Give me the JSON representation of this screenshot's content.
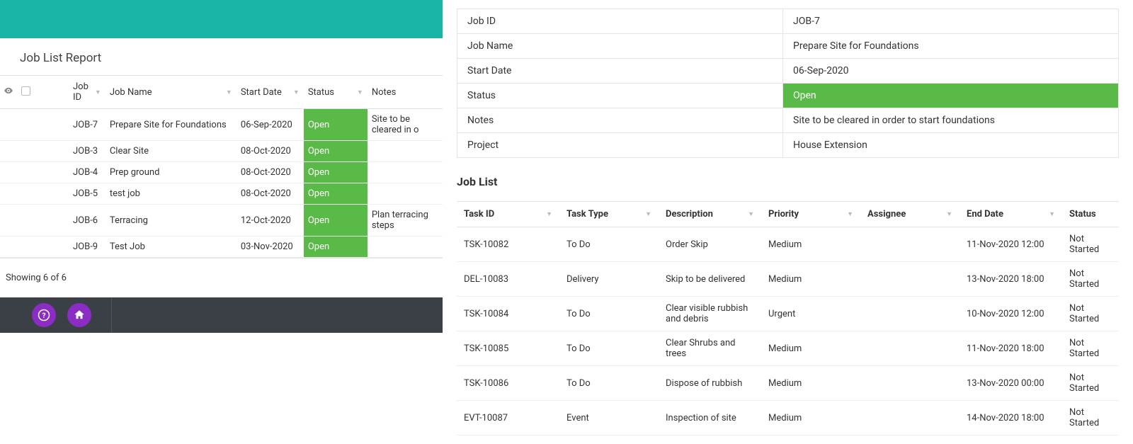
{
  "colors": {
    "teal": "#1bb5a7",
    "green": "#5aba47",
    "purple": "#8b2cc4",
    "darkFooter": "#3b3f46"
  },
  "left": {
    "reportTitle": "Job List Report",
    "headers": {
      "jobId": "Job ID",
      "jobName": "Job Name",
      "startDate": "Start Date",
      "status": "Status",
      "notes": "Notes"
    },
    "rows": [
      {
        "jobId": "JOB-7",
        "jobName": "Prepare Site for Foundations",
        "startDate": "06-Sep-2020",
        "status": "Open",
        "notes": "Site to be cleared in o"
      },
      {
        "jobId": "JOB-3",
        "jobName": "Clear Site",
        "startDate": "08-Oct-2020",
        "status": "Open",
        "notes": ""
      },
      {
        "jobId": "JOB-4",
        "jobName": "Prep ground",
        "startDate": "08-Oct-2020",
        "status": "Open",
        "notes": ""
      },
      {
        "jobId": "JOB-5",
        "jobName": "test job",
        "startDate": "08-Oct-2020",
        "status": "Open",
        "notes": ""
      },
      {
        "jobId": "JOB-6",
        "jobName": "Terracing",
        "startDate": "12-Oct-2020",
        "status": "Open",
        "notes": "Plan terracing steps"
      },
      {
        "jobId": "JOB-9",
        "jobName": "Test Job",
        "startDate": "03-Nov-2020",
        "status": "Open",
        "notes": ""
      }
    ],
    "recordCount": "Showing 6 of 6"
  },
  "detail": {
    "fields": {
      "jobIdLabel": "Job ID",
      "jobId": "JOB-7",
      "jobNameLabel": "Job Name",
      "jobName": "Prepare Site for Foundations",
      "startDateLabel": "Start Date",
      "startDate": "06-Sep-2020",
      "statusLabel": "Status",
      "status": "Open",
      "notesLabel": "Notes",
      "notes": "Site to be cleared in order to start foundations",
      "projectLabel": "Project",
      "project": "House Extension"
    },
    "jobListHeading": "Job List",
    "taskHeaders": {
      "taskId": "Task ID",
      "taskType": "Task Type",
      "description": "Description",
      "priority": "Priority",
      "assignee": "Assignee",
      "endDate": "End Date",
      "status": "Status"
    },
    "tasks": [
      {
        "taskId": "TSK-10082",
        "taskType": "To Do",
        "description": "Order Skip",
        "priority": "Medium",
        "assignee": "",
        "endDate": "11-Nov-2020 12:00",
        "status": "Not Started"
      },
      {
        "taskId": "DEL-10083",
        "taskType": "Delivery",
        "description": "Skip to be delivered",
        "priority": "Medium",
        "assignee": "",
        "endDate": "13-Nov-2020 18:00",
        "status": "Not Started"
      },
      {
        "taskId": "TSK-10084",
        "taskType": "To Do",
        "description": "Clear visible rubbish and debris",
        "priority": "Urgent",
        "assignee": "",
        "endDate": "10-Nov-2020 12:00",
        "status": "Not Started"
      },
      {
        "taskId": "TSK-10085",
        "taskType": "To Do",
        "description": "Clear Shrubs and trees",
        "priority": "Medium",
        "assignee": "",
        "endDate": "11-Nov-2020 18:00",
        "status": "Not Started"
      },
      {
        "taskId": "TSK-10086",
        "taskType": "To Do",
        "description": "Dispose of rubbish",
        "priority": "Medium",
        "assignee": "",
        "endDate": "13-Nov-2020 00:00",
        "status": "Not Started"
      },
      {
        "taskId": "EVT-10087",
        "taskType": "Event",
        "description": "Inspection of site",
        "priority": "Medium",
        "assignee": "",
        "endDate": "14-Nov-2020 18:00",
        "status": "Not Started"
      }
    ]
  }
}
